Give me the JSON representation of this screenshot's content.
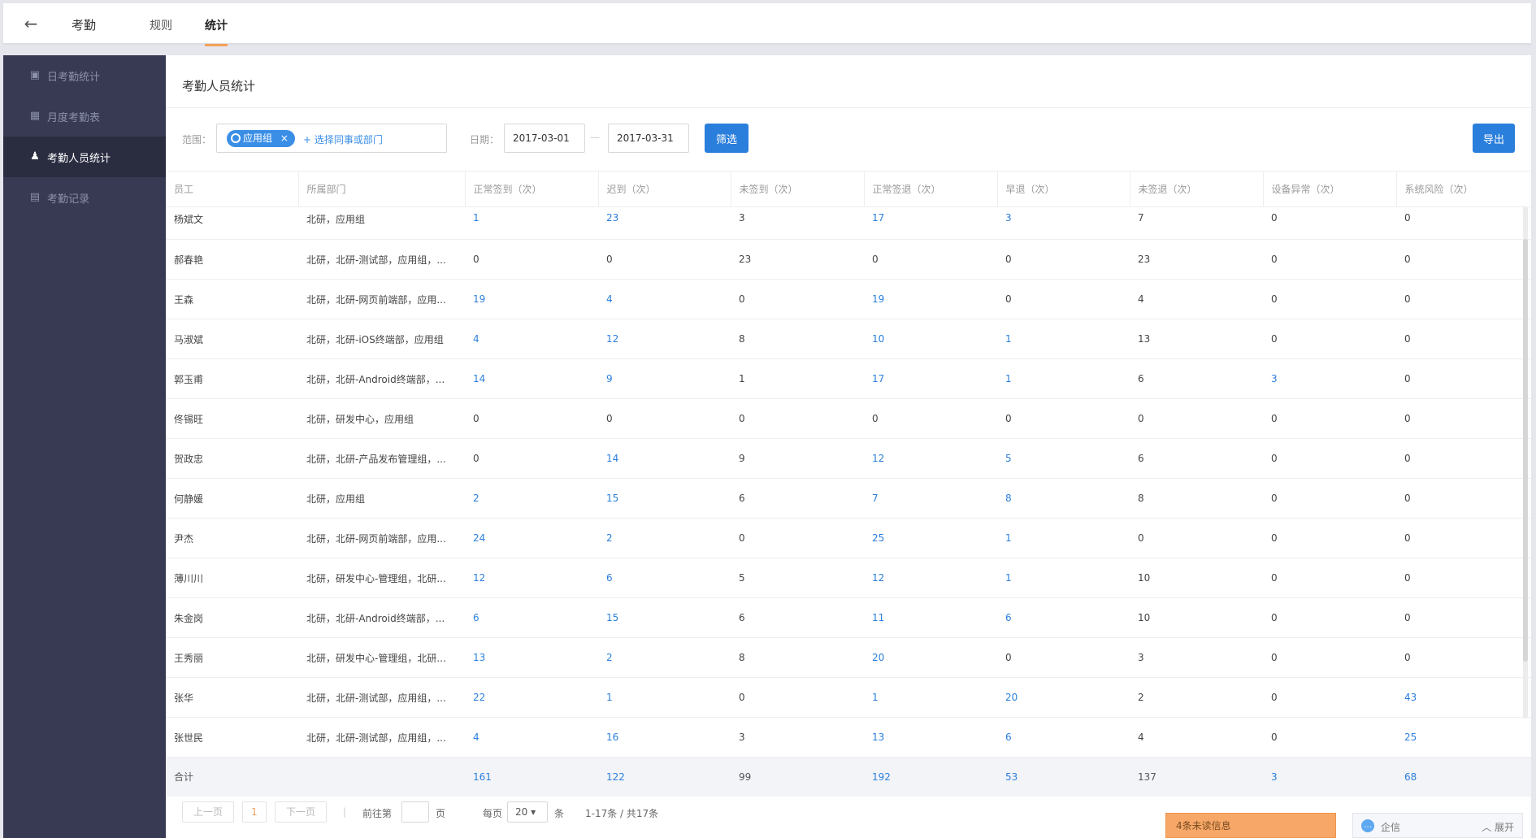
{
  "header": {
    "back_icon": "←",
    "app_title": "考勤",
    "tabs": [
      {
        "label": "规则"
      },
      {
        "label": "统计"
      }
    ]
  },
  "sidebar": {
    "items": [
      {
        "label": "日考勤统计",
        "icon": "calendar-check-icon"
      },
      {
        "label": "月度考勤表",
        "icon": "calendar-icon"
      },
      {
        "label": "考勤人员统计",
        "icon": "user-stats-icon"
      },
      {
        "label": "考勤记录",
        "icon": "document-icon"
      }
    ]
  },
  "main": {
    "title": "考勤人员统计",
    "filter": {
      "scope_label": "范围：",
      "scope_tag": "应用组",
      "scope_tag_close": "×",
      "add_link": "+ 选择同事或部门",
      "date_label": "日期：",
      "date_start": "2017-03-01",
      "date_sep": "—",
      "date_end": "2017-03-31",
      "filter_button": "筛选",
      "export_button": "导出"
    },
    "table": {
      "headers": [
        "员工",
        "所属部门",
        "正常签到（次）",
        "迟到（次）",
        "未签到（次）",
        "正常签退（次）",
        "早退（次）",
        "未签退（次）",
        "设备异常（次）",
        "系统风险（次）"
      ],
      "rows": [
        [
          "杨斌文",
          "北研，应用组",
          "1",
          "23",
          "3",
          "17",
          "3",
          "7",
          "0",
          "0"
        ],
        [
          "郝春艳",
          "北研，北研-测试部，应用组，...",
          "0",
          "0",
          "23",
          "0",
          "0",
          "23",
          "0",
          "0"
        ],
        [
          "王森",
          "北研，北研-网页前端部，应用...",
          "19",
          "4",
          "0",
          "19",
          "0",
          "4",
          "0",
          "0"
        ],
        [
          "马淑斌",
          "北研，北研-iOS终端部，应用组",
          "4",
          "12",
          "8",
          "10",
          "1",
          "13",
          "0",
          "0"
        ],
        [
          "郭玉甫",
          "北研，北研-Android终端部，...",
          "14",
          "9",
          "1",
          "17",
          "1",
          "6",
          "3",
          "0"
        ],
        [
          "佟锡旺",
          "北研，研发中心，应用组",
          "0",
          "0",
          "0",
          "0",
          "0",
          "0",
          "0",
          "0"
        ],
        [
          "贺政忠",
          "北研，北研-产品发布管理组，...",
          "0",
          "14",
          "9",
          "12",
          "5",
          "6",
          "0",
          "0"
        ],
        [
          "何静媛",
          "北研，应用组",
          "2",
          "15",
          "6",
          "7",
          "8",
          "8",
          "0",
          "0"
        ],
        [
          "尹杰",
          "北研，北研-网页前端部，应用...",
          "24",
          "2",
          "0",
          "25",
          "1",
          "0",
          "0",
          "0"
        ],
        [
          "薄川川",
          "北研，研发中心-管理组，北研...",
          "12",
          "6",
          "5",
          "12",
          "1",
          "10",
          "0",
          "0"
        ],
        [
          "朱金岗",
          "北研，北研-Android终端部，...",
          "6",
          "15",
          "6",
          "11",
          "6",
          "10",
          "0",
          "0"
        ],
        [
          "王秀丽",
          "北研，研发中心-管理组，北研...",
          "13",
          "2",
          "8",
          "20",
          "0",
          "3",
          "0",
          "0"
        ],
        [
          "张华",
          "北研，北研-测试部，应用组，...",
          "22",
          "1",
          "0",
          "1",
          "20",
          "2",
          "0",
          "43"
        ],
        [
          "张世民",
          "北研，北研-测试部，应用组，...",
          "4",
          "16",
          "3",
          "13",
          "6",
          "4",
          "0",
          "25"
        ]
      ],
      "link_columns": [
        2,
        3,
        5,
        6,
        8,
        9
      ],
      "total": [
        "合计",
        "",
        "161",
        "122",
        "99",
        "192",
        "53",
        "137",
        "3",
        "68"
      ]
    },
    "pager": {
      "prev": "上一页",
      "current_page": "1",
      "next": "下一页",
      "sep": "|",
      "goto_prefix": "前往第",
      "goto_suffix": "页",
      "per_page_label": "每页",
      "per_page_value": "20 ▾",
      "per_page_unit": "条",
      "summary": "1-17条 / 共17条"
    }
  },
  "footer": {
    "unread": "4条未读信息",
    "qixin_icon": "…",
    "qixin_label": "企信",
    "expand_label": "︿ 展开"
  },
  "colors": {
    "accent": "#2b7fdc",
    "sidebar_bg": "#373a52",
    "active_tab": "#f5a05a"
  }
}
